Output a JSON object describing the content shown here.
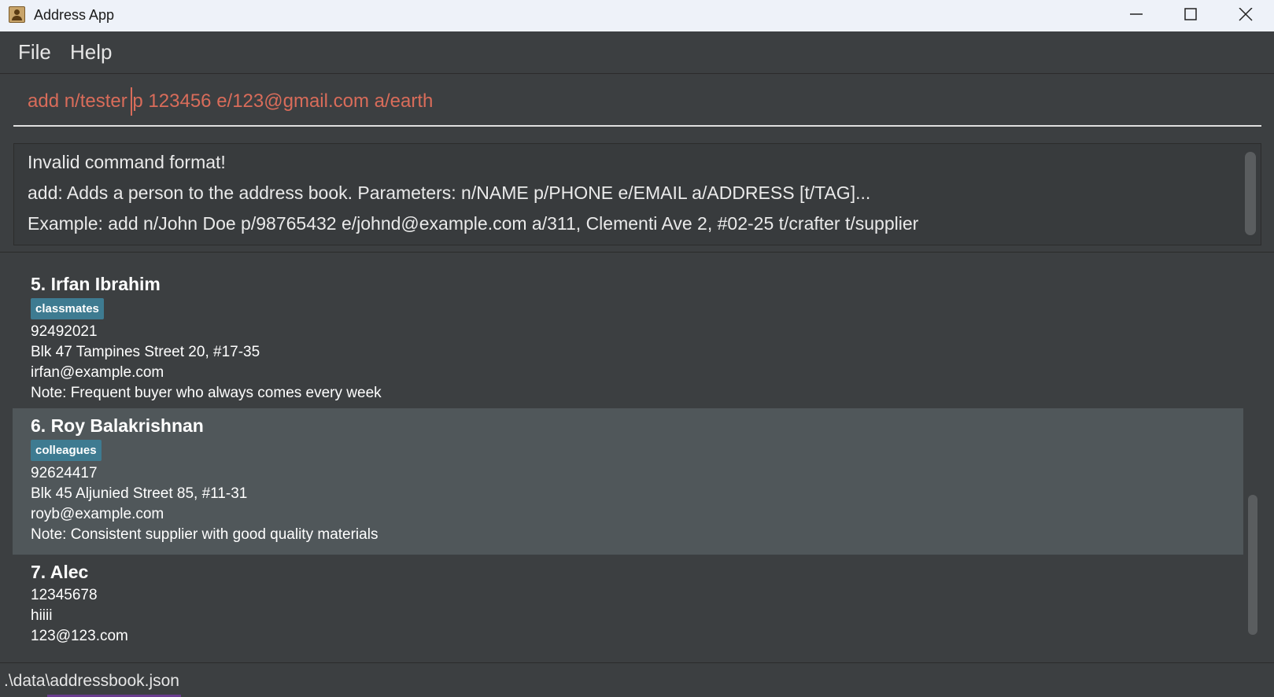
{
  "window": {
    "title": "Address App",
    "icon": "contact-book-icon",
    "controls": [
      "minimize-icon",
      "maximize-icon",
      "close-icon"
    ]
  },
  "menu": {
    "items": [
      {
        "label": "File"
      },
      {
        "label": "Help"
      }
    ]
  },
  "command_box": {
    "value": "add n/tester p 123456 e/123@gmail.com a/earth",
    "text_color": "#d96c5a"
  },
  "result_display": {
    "lines": [
      "Invalid command format!",
      "add: Adds a person to the address book. Parameters: n/NAME p/PHONE e/EMAIL a/ADDRESS [t/TAG]...",
      "Example: add n/John Doe p/98765432 e/johnd@example.com a/311, Clementi Ave 2, #02-25 t/crafter t/supplier"
    ]
  },
  "person_list": {
    "tag_color": "#3e7b91",
    "selected_color": "#50575a",
    "persons": [
      {
        "name": "5. Irfan Ibrahim",
        "tags": [
          "classmates"
        ],
        "phone": "92492021",
        "address": "Blk 47 Tampines Street 20, #17-35",
        "email": "irfan@example.com",
        "note": "Note: Frequent buyer who always comes every week",
        "selected": false
      },
      {
        "name": "6. Roy Balakrishnan",
        "tags": [
          "colleagues"
        ],
        "phone": "92624417",
        "address": "Blk 45 Aljunied Street 85, #11-31",
        "email": "royb@example.com",
        "note": "Note: Consistent supplier with good quality materials",
        "selected": true
      },
      {
        "name": "7. Alec",
        "tags": [],
        "phone": "12345678",
        "address": "hiiii",
        "email": "123@123.com",
        "selected": false
      }
    ]
  },
  "status_bar": {
    "path": ".\\data\\addressbook.json"
  }
}
